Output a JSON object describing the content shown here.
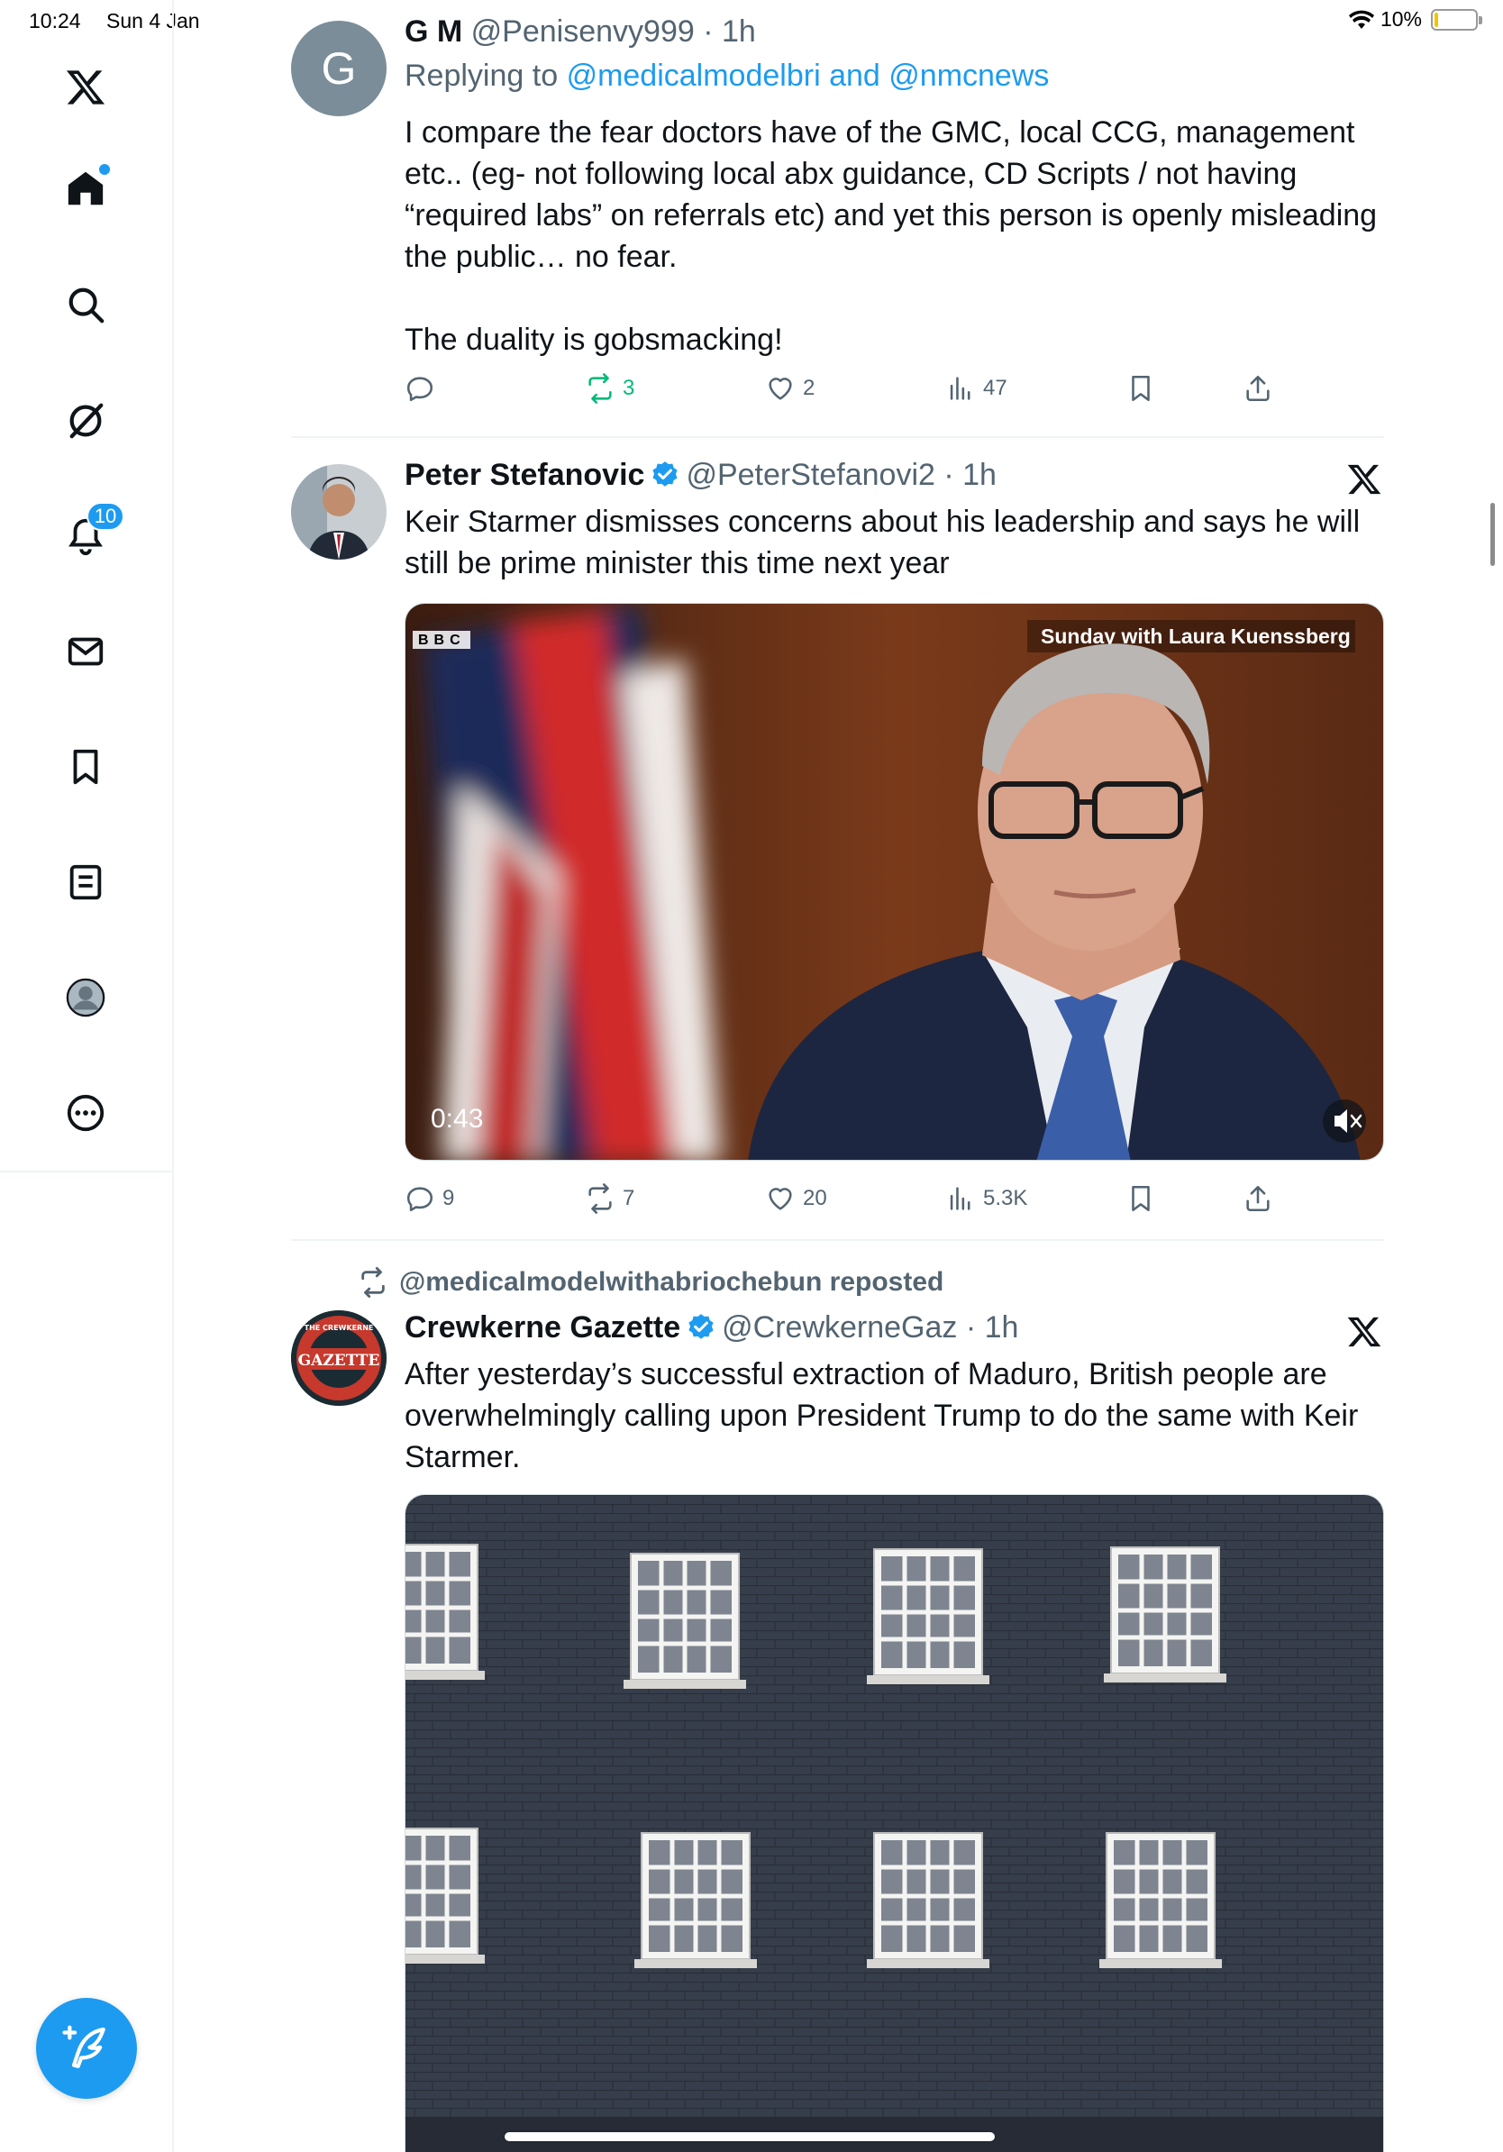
{
  "status_bar": {
    "time": "10:24",
    "date": "Sun 4 Jan",
    "battery": "10%",
    "battery_level": 0.1
  },
  "sidebar": {
    "notifications_badge": "10",
    "items": [
      "x-logo",
      "home",
      "search",
      "grok",
      "notifications",
      "messages",
      "bookmarks",
      "lists",
      "profile",
      "more"
    ]
  },
  "tweets": [
    {
      "name": "G M",
      "handle": "@Penisenvy999",
      "time": "· 1h",
      "avatar_letter": "G",
      "reply_prefix": "Replying to",
      "reply_to_1": "@medicalmodelbri",
      "reply_and": "and",
      "reply_to_2": "@nmcnews",
      "text": "I compare the fear doctors have of the GMC, local CCG, management etc.. (eg- not following local abx guidance, CD Scripts / not having “required labs” on referrals etc) and yet this person is openly misleading the public… no fear.\n\nThe duality is gobsmacking!",
      "replies": "",
      "reposts": "3",
      "likes": "2",
      "views": "47"
    },
    {
      "name": "Peter Stefanovic",
      "handle": "@PeterStefanovi2",
      "time": "· 1h",
      "text": "Keir Starmer dismisses concerns about his leadership and says he will still be prime minister this time next year",
      "video_duration": "0:43",
      "video_overlay": "Sunday with Laura Kuenssberg",
      "video_logo": "BBC",
      "replies": "9",
      "reposts": "7",
      "likes": "20",
      "views": "5.3K"
    },
    {
      "repost_label": "@medicalmodelwithabriochebun reposted",
      "name": "Crewkerne Gazette",
      "handle": "@CrewkerneGaz",
      "time": "· 1h",
      "avatar_text_top": "THE CREWKERNE",
      "avatar_text_main": "GAZETTE",
      "text": "After yesterday’s successful extraction of Maduro, British people are overwhelmingly calling upon President Trump to do the same with Keir Starmer."
    }
  ],
  "colors": {
    "accent": "#1d9bf0",
    "repost_green": "#00ba7c",
    "secondary_text": "#536471"
  }
}
